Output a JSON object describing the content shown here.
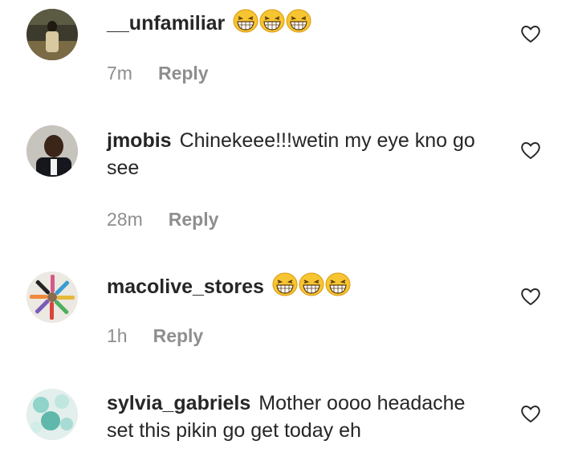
{
  "comments": [
    {
      "username": "__unfamiliar",
      "text": "",
      "emoji_count": 3,
      "time": "7m",
      "reply_label": "Reply"
    },
    {
      "username": "jmobis",
      "text": "Chinekeee!!!wetin my eye kno go see",
      "emoji_count": 0,
      "time": "28m",
      "reply_label": "Reply"
    },
    {
      "username": "macolive_stores",
      "text": "",
      "emoji_count": 3,
      "time": "1h",
      "reply_label": "Reply"
    },
    {
      "username": "sylvia_gabriels",
      "text": "Mother oooo headache set this pikin go get today eh",
      "emoji_count": 0,
      "time": "",
      "reply_label": ""
    }
  ],
  "icons": {
    "like": "heart-outline-icon",
    "emoji": "grinning-squinting-face-icon"
  },
  "colors": {
    "text": "#262626",
    "meta": "#8e8e8e",
    "emoji_face": "#f7c531"
  }
}
